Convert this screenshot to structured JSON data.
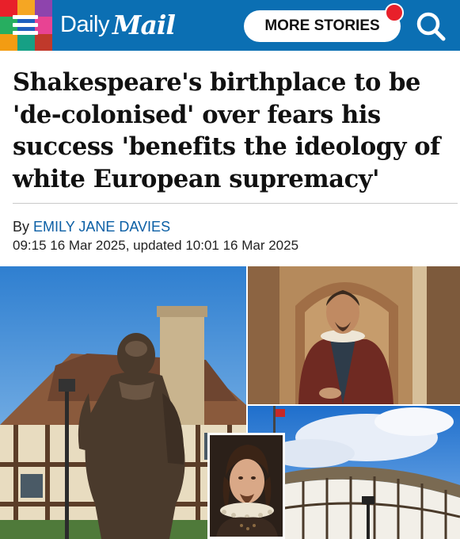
{
  "header": {
    "logo_daily": "Daily",
    "logo_mail": "Mail",
    "more_stories_label": "MORE STORIES"
  },
  "article": {
    "headline": "Shakespeare's birthplace to be 'de-colonised' over fears his success 'benefits the ideology of white European supremacy'",
    "byline_prefix": "By ",
    "author": "EMILY JANE DAVIES",
    "dateline": "09:15 16 Mar 2025, updated 10:01 16 Mar 2025"
  },
  "colors": {
    "header_blue": "#0b6fb3",
    "author_link": "#0b5fa5",
    "notification_dot": "#e8202a"
  }
}
